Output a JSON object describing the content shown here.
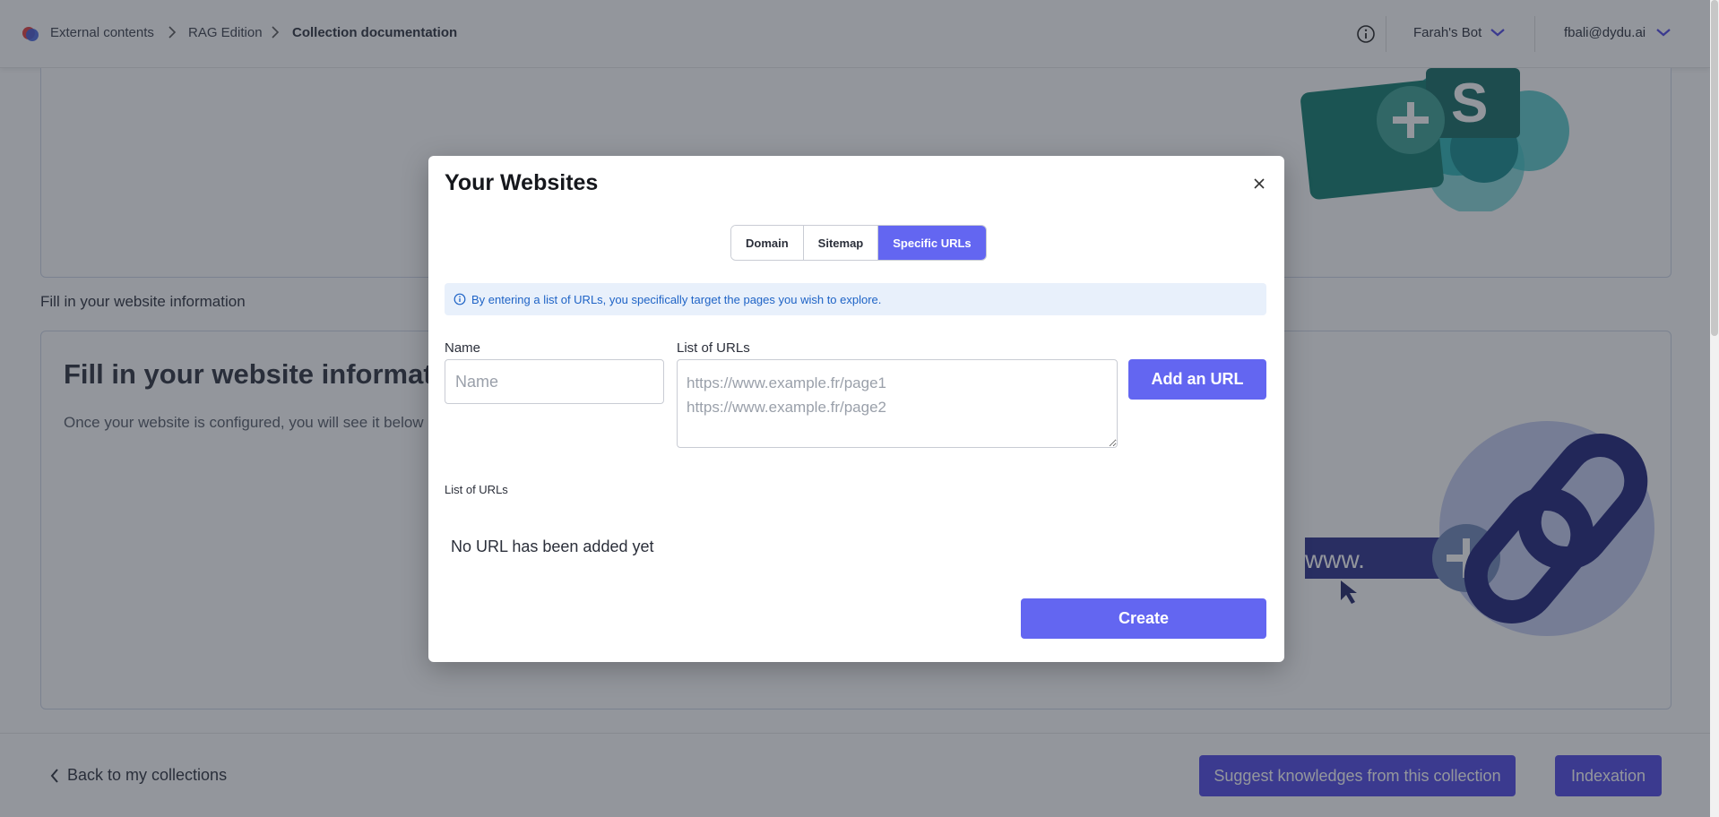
{
  "breadcrumb": {
    "items": [
      "External contents",
      "RAG Edition"
    ],
    "current": "Collection documentation"
  },
  "header": {
    "bot_name": "Farah's Bot",
    "user_email": "fbali@dydu.ai"
  },
  "page": {
    "section_label": "Fill in your website information",
    "card_title": "Fill in your website information",
    "card_subtitle": "Once your website is configured, you will see it below",
    "sharepoint_letter": "S",
    "www_text": "www."
  },
  "footer": {
    "back_label": "Back to my collections",
    "suggest_label": "Suggest knowledges from this collection",
    "indexation_label": "Indexation"
  },
  "modal": {
    "title": "Your Websites",
    "tabs": [
      {
        "label": "Domain",
        "active": false
      },
      {
        "label": "Sitemap",
        "active": false
      },
      {
        "label": "Specific URLs",
        "active": true
      }
    ],
    "info_text": "By entering a list of URLs, you specifically target the pages you wish to explore.",
    "name_label": "Name",
    "name_placeholder": "Name",
    "name_value": "",
    "urls_label": "List of URLs",
    "urls_placeholder": "https://www.example.fr/page1\nhttps://www.example.fr/page2",
    "add_url_label": "Add an URL",
    "list_heading": "List of URLs",
    "empty_text": "No URL has been added yet",
    "create_label": "Create"
  },
  "colors": {
    "primary": "#6366f1",
    "primary_dark": "#4f46e5",
    "info_bg": "#e8f0fb",
    "info_text": "#1e63c6",
    "overlay": "rgba(40,46,58,0.5)"
  }
}
